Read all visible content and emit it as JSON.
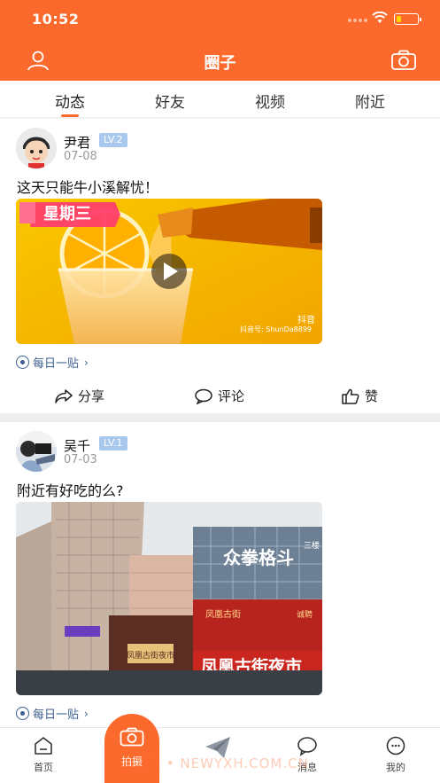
{
  "status": {
    "time": "10:52"
  },
  "header": {
    "title": "圈子"
  },
  "tabs": [
    {
      "label": "动态",
      "active": true
    },
    {
      "label": "好友",
      "active": false
    },
    {
      "label": "视频",
      "active": false
    },
    {
      "label": "附近",
      "active": false
    }
  ],
  "posts": [
    {
      "user": "尹君",
      "level": "LV.2",
      "date": "07-08",
      "text": "这天只能牛小溪解忧！",
      "media": {
        "type": "video",
        "badge": "星期三",
        "watermark_top": "抖音",
        "watermark_id": "抖音号: ShunDa8899"
      },
      "tag": "每日一贴",
      "actions": {
        "share": "分享",
        "comment": "评论",
        "like": "赞"
      }
    },
    {
      "user": "吴千",
      "level": "LV.1",
      "date": "07-03",
      "text": "附近有好吃的么?",
      "media": {
        "type": "image",
        "sign1": "众拳格斗",
        "sign1_side": "三楼",
        "sign2": "凤凰古街夜市",
        "sign3": "凤凰古街夜市",
        "sign4": "凤凰古街",
        "sign5": "诚聘"
      },
      "tag": "每日一贴"
    }
  ],
  "bottom_nav": {
    "home": "首页",
    "shoot": "拍摄",
    "messages": "消息",
    "mine": "我的"
  },
  "watermark": "玩意下载 • NEWYXH.COM.CN",
  "colors": {
    "accent": "#fb6a2c",
    "level_badge": "#a9c8ee",
    "tag": "#3b5f8e"
  }
}
